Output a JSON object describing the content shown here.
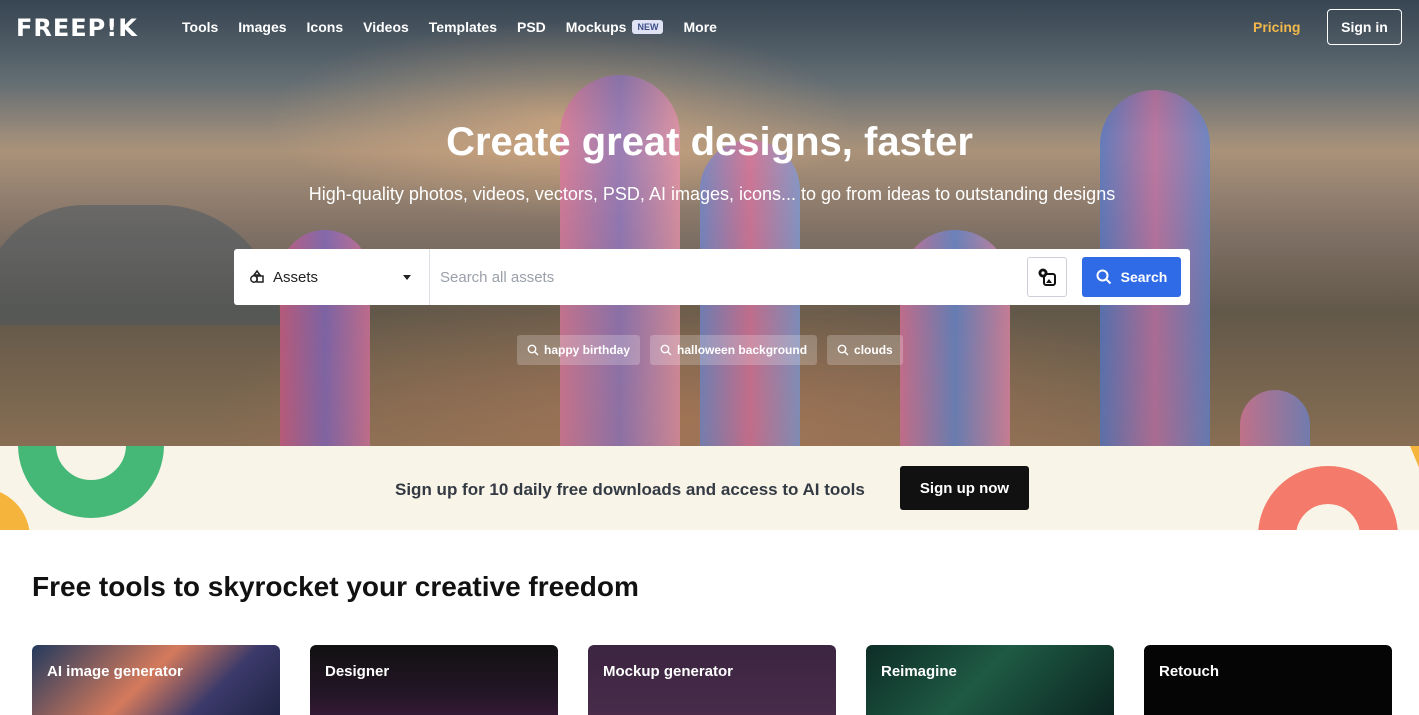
{
  "nav": {
    "logo": "FREEP!K",
    "links": [
      "Tools",
      "Images",
      "Icons",
      "Videos",
      "Templates",
      "PSD",
      "Mockups",
      "More"
    ],
    "mockups_badge": "NEW",
    "pricing": "Pricing",
    "signin": "Sign in"
  },
  "hero": {
    "title": "Create great designs, faster",
    "subtitle": "High-quality photos, videos, vectors, PSD, AI images, icons... to go from ideas to outstanding designs"
  },
  "search": {
    "category": "Assets",
    "placeholder": "Search all assets",
    "value": "",
    "button": "Search",
    "suggestions": [
      "happy birthday",
      "halloween background",
      "clouds"
    ]
  },
  "banner": {
    "text": "Sign up for 10 daily free downloads and access to AI tools",
    "button": "Sign up now"
  },
  "tools": {
    "heading": "Free tools to skyrocket your creative freedom",
    "cards": [
      "AI image generator",
      "Designer",
      "Mockup generator",
      "Reimagine",
      "Retouch"
    ]
  },
  "colors": {
    "accent_blue": "#2f6be6",
    "pricing_gold": "#f2b84b",
    "banner_bg": "#f8f4e7"
  }
}
